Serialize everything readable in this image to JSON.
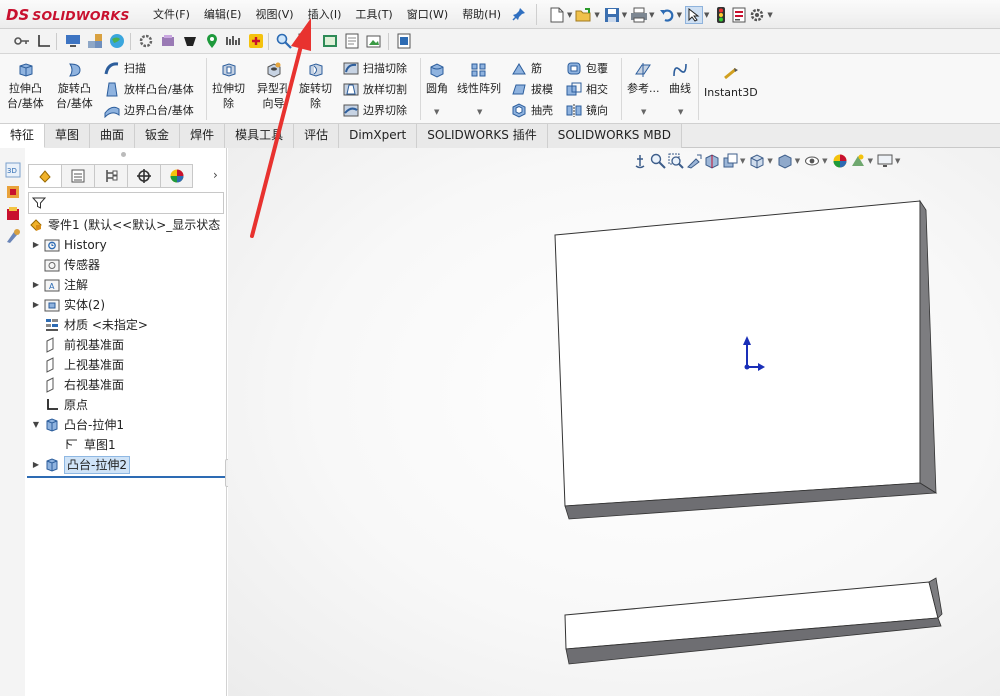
{
  "app": {
    "logo_ds": "DS",
    "logo_name": "SOLIDWORKS",
    "brand_color": "#c8102e",
    "accent_color": "#2d6bb3",
    "annotation_color": "#e8322f"
  },
  "menu": [
    "文件(F)",
    "编辑(E)",
    "视图(V)",
    "插入(I)",
    "工具(T)",
    "窗口(W)",
    "帮助(H)"
  ],
  "command_manager": {
    "extrude_boss": [
      "拉伸凸",
      "台/基体"
    ],
    "revolve_boss": [
      "旋转凸",
      "台/基体"
    ],
    "sweep": "扫描",
    "loft_boss": "放样凸台/基体",
    "boundary_boss": "边界凸台/基体",
    "extrude_cut": [
      "拉伸切",
      "除"
    ],
    "hole_wizard": [
      "异型孔",
      "向导"
    ],
    "revolve_cut": [
      "旋转切",
      "除"
    ],
    "sweep_cut": "扫描切除",
    "loft_cut": "放样切割",
    "boundary_cut": "边界切除",
    "fillet": "圆角",
    "linear_pattern": "线性阵列",
    "rib": "筋",
    "draft": "拔模",
    "shell": "抽壳",
    "wrap": "包覆",
    "intersect": "相交",
    "mirror": "镜向",
    "reference": "参考...",
    "curves": "曲线",
    "instant3d": "Instant3D"
  },
  "tabs": [
    "特征",
    "草图",
    "曲面",
    "钣金",
    "焊件",
    "模具工具",
    "评估",
    "DimXpert",
    "SOLIDWORKS 插件",
    "SOLIDWORKS MBD"
  ],
  "feature_tree": {
    "root": "零件1 (默认<<默认>_显示状态",
    "items": [
      {
        "label": "History",
        "expandable": true
      },
      {
        "label": "传感器",
        "expandable": false
      },
      {
        "label": "注解",
        "expandable": true
      },
      {
        "label": "实体(2)",
        "expandable": true
      },
      {
        "label": "材质 <未指定>",
        "expandable": false
      },
      {
        "label": "前视基准面",
        "expandable": false
      },
      {
        "label": "上视基准面",
        "expandable": false
      },
      {
        "label": "右视基准面",
        "expandable": false
      },
      {
        "label": "原点",
        "expandable": false
      },
      {
        "label": "凸台-拉伸1",
        "expandable": true,
        "expanded": true
      },
      {
        "label": "草图1",
        "expandable": false,
        "child": true
      },
      {
        "label": "凸台-拉伸2",
        "expandable": true,
        "selected": true
      }
    ]
  }
}
